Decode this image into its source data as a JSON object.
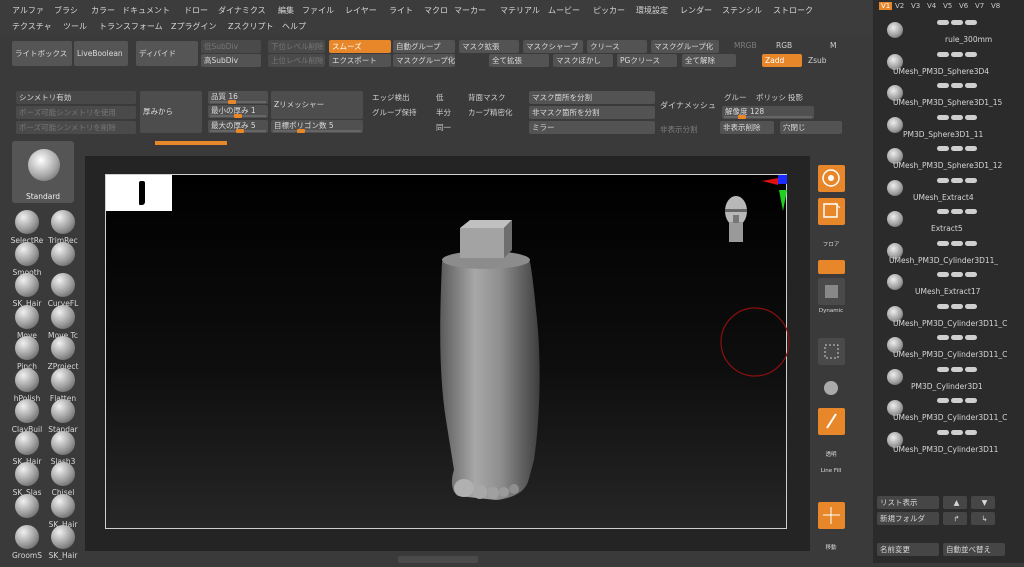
{
  "menus": {
    "row1": [
      "アルファ",
      "ブラシ",
      "カラー",
      "ドキュメント",
      "ドロー",
      "ダイナミクス",
      "編集",
      "ファイル",
      "レイヤー",
      "ライト",
      "マクロ",
      "マーカー",
      "マテリアル",
      "ムービー",
      "ピッカー",
      "環境設定",
      "レンダー",
      "ステンシル",
      "ストローク"
    ],
    "row2": [
      "テクスチャ",
      "ツール",
      "トランスフォーム",
      "Zプラグイン",
      "Zスクリプト",
      "ヘルプ"
    ]
  },
  "toolbar": {
    "lightbox": "ライトボックス",
    "liveboolean": "LiveBoolean",
    "divide": "ディバイド",
    "lowsubdiv": "低SubDiv",
    "highsubdiv": "高SubDiv",
    "lowerlevel_delete": "下位レベル削除",
    "upperlevel_delete": "上位レベル削除",
    "smooth": "スムーズ",
    "export": "エクスポート",
    "autogroup": "自動グループ",
    "maskgroup": "マスクグループ化",
    "maskexpand": "マスク拡張",
    "allexpand": "全て拡張",
    "masksharpen": "マスクシャープ",
    "maskblur": "マスクぼかし",
    "crease": "クリース",
    "pgcrease": "PGクリース",
    "maskgroupify": "マスクグループ化",
    "allrelease": "全て解除",
    "mrgb": "MRGB",
    "rgb": "RGB",
    "m": "M",
    "zadd": "Zadd",
    "zsub": "Zsub"
  },
  "row3": {
    "symmetry": "シンメトリ有効",
    "pose_sym": "ポーズ可能シンメトリを使用",
    "pose_sym_del": "ポーズ可能シンメトリを削除",
    "thickness": "厚みから",
    "quality_label": "品質",
    "quality_value": "16",
    "minthick_label": "最小の厚み",
    "minthick_value": "1",
    "maxthick_label": "最大の厚み",
    "maxthick_value": "5",
    "zremesher": "Zリメッシャー",
    "targetpoly_label": "目標ポリゴン数",
    "targetpoly_value": "5",
    "edge_detect": "エッジ検出",
    "group_keep": "グループ保持",
    "low": "低",
    "half": "半分",
    "same": "同一",
    "backmask": "背面マスク",
    "curve_strength": "カーブ精密化",
    "mask_split": "マスク箇所を分割",
    "nonmask_split": "非マスク箇所を分割",
    "mirror": "ミラー",
    "dynamesh": "ダイナメッシュ",
    "group_label": "グルー",
    "polish_label": "ポリッシ",
    "project_label": "投影",
    "resolution_label": "解像度",
    "resolution_value": "128",
    "nonmask_only": "非表示分割",
    "nondisplay_delete": "非表示削除",
    "hole_close": "穴閉じ"
  },
  "left": {
    "current_brush": "Standard",
    "brushes": [
      "SelectRe",
      "TrimRec",
      "Smooth",
      "",
      "SK_Hair",
      "CurveFL",
      "Move",
      "Move Tc",
      "Pinch",
      "ZProject",
      "hPolish",
      "Flatten",
      "ClayBuil",
      "Standar",
      "SK_Hair",
      "Slash3",
      "SK_Slas",
      "Chisel",
      "",
      "SK_Hair",
      "GroomS",
      "SK_Hair"
    ]
  },
  "right_tools": {
    "labels": [
      "",
      "",
      "フロア",
      "",
      "ダイナ",
      "Dynamic\nソース",
      "",
      "ソロ",
      "",
      "透明",
      "Line Fill\nポリF",
      "",
      "移動"
    ]
  },
  "subtool": {
    "version_tabs": [
      "V1",
      "V2",
      "V3",
      "V4",
      "V5",
      "V6",
      "V7",
      "V8"
    ],
    "items": [
      "rule_300mm",
      "UMesh_PM3D_Sphere3D4",
      "UMesh_PM3D_Sphere3D1_15",
      "PM3D_Sphere3D1_11",
      "UMesh_PM3D_Sphere3D1_12",
      "UMesh_Extract4",
      "Extract5",
      "UMesh_PM3D_Cylinder3D11_",
      "UMesh_Extract17",
      "UMesh_PM3D_Cylinder3D11_C",
      "UMesh_PM3D_Cylinder3D11_C",
      "PM3D_Cylinder3D1",
      "UMesh_PM3D_Cylinder3D11_C",
      "UMesh_PM3D_Cylinder3D11"
    ],
    "list_view": "リスト表示",
    "new_folder": "新規フォルダ",
    "rename": "名前変更",
    "auto_sort": "自動並べ替え"
  },
  "colors": {
    "accent": "#e8872a",
    "panel": "#3a3a3a"
  }
}
